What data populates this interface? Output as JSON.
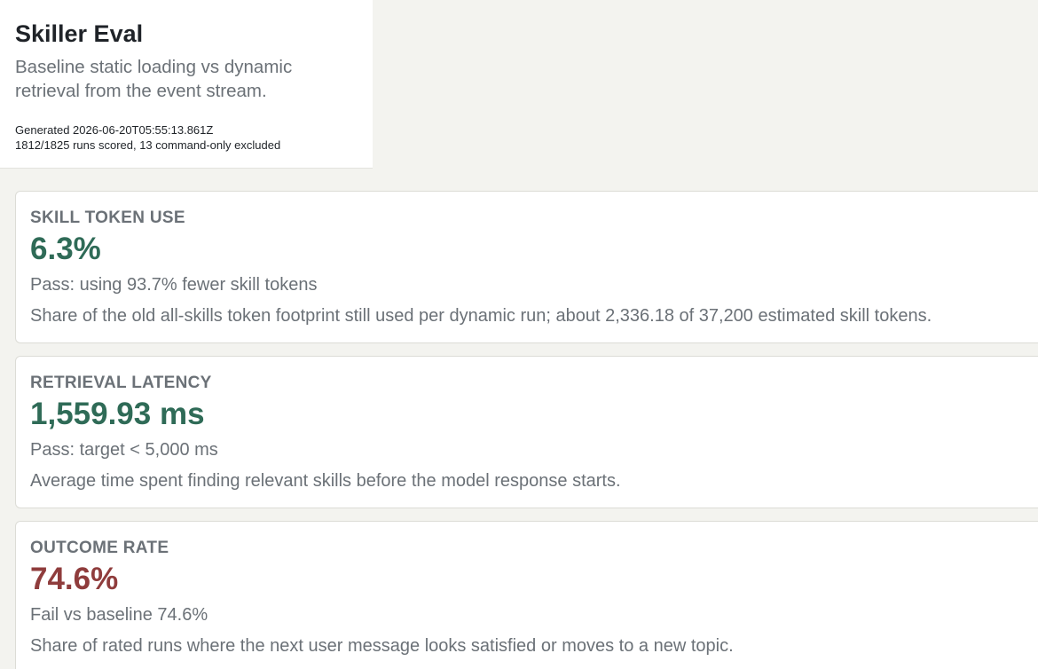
{
  "header": {
    "title": "Skiller Eval",
    "subtitle": "Baseline static loading vs dynamic retrieval from the event stream.",
    "generated": "Generated 2026-06-20T05:55:13.861Z",
    "runs": "1812/1825 runs scored, 13 command-only excluded"
  },
  "colors": {
    "pass": "#2f6b57",
    "fail": "#8f3c3c",
    "muted": "#6b7177"
  },
  "metrics": [
    {
      "label": "SKILL TOKEN USE",
      "value": "6.3%",
      "result": "pass",
      "status": "Pass: using 93.7% fewer skill tokens",
      "description": "Share of the old all-skills token footprint still used per dynamic run; about 2,336.18 of 37,200 estimated skill tokens."
    },
    {
      "label": "RETRIEVAL LATENCY",
      "value": "1,559.93 ms",
      "result": "pass",
      "status": "Pass: target < 5,000 ms",
      "description": "Average time spent finding relevant skills before the model response starts."
    },
    {
      "label": "OUTCOME RATE",
      "value": "74.6%",
      "result": "fail",
      "status": "Fail vs baseline 74.6%",
      "description": "Share of rated runs where the next user message looks satisfied or moves to a new topic."
    }
  ]
}
